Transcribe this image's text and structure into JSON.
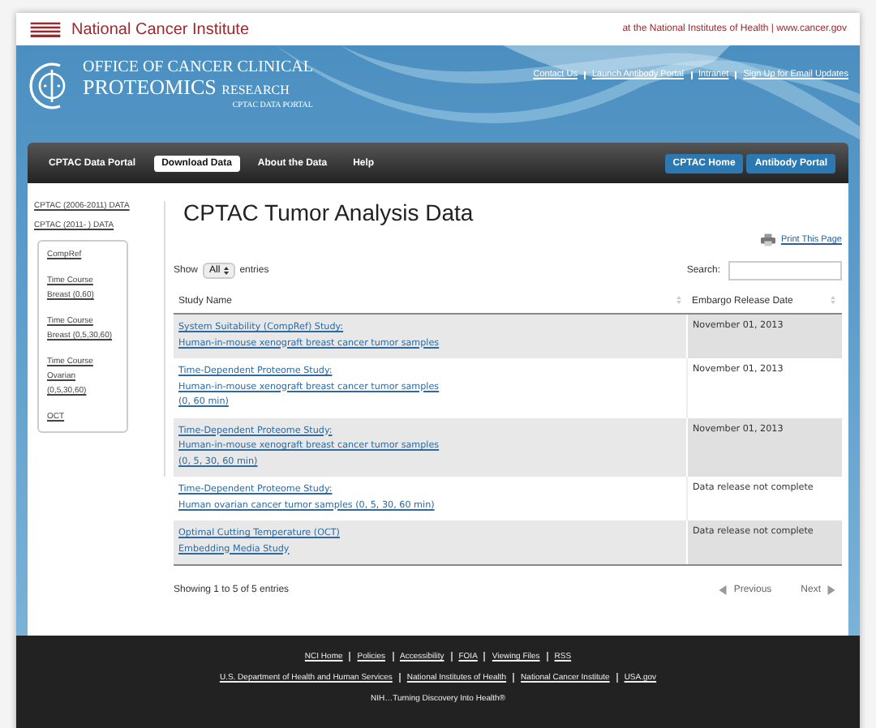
{
  "nci_bar": {
    "title": "National Cancer Institute",
    "tagline": "at the National Institutes of Health | www.cancer.gov"
  },
  "header": {
    "title_line1": "OFFICE OF CANCER CLINICAL",
    "title_line2": "PROTEOMICS",
    "title_line2_small": "RESEARCH",
    "subtitle": "CPTAC DATA PORTAL",
    "links": [
      "Contact Us",
      "Launch Antibody Portal",
      "Intranet",
      "Sign Up for Email Updates"
    ]
  },
  "nav": {
    "items": [
      {
        "label": "CPTAC Data Portal",
        "selected": false
      },
      {
        "label": "Download Data",
        "selected": true
      },
      {
        "label": "About the Data",
        "selected": false
      },
      {
        "label": "Help",
        "selected": false
      }
    ],
    "right_buttons": [
      "CPTAC Home",
      "Antibody Portal"
    ]
  },
  "sidebar": {
    "links": [
      "CPTAC (2006-2011) DATA",
      "CPTAC (2011- ) DATA"
    ],
    "box_items": [
      {
        "lines": [
          "CompRef"
        ]
      },
      {
        "lines": [
          "Time Course",
          "Breast (0,60)"
        ]
      },
      {
        "lines": [
          "Time Course",
          "Breast (0,5,30,60)"
        ]
      },
      {
        "lines": [
          "Time Course",
          "Ovarian",
          "(0,5,30,60)"
        ]
      },
      {
        "lines": [
          "OCT"
        ]
      }
    ]
  },
  "main": {
    "title": "CPTAC Tumor Analysis Data",
    "print_link": "Print This Page",
    "show_label": "Show",
    "show_value": "All",
    "entries_label": "entries",
    "search_label": "Search:",
    "table": {
      "columns": [
        "Study Name",
        "Embargo Release Date"
      ],
      "rows": [
        {
          "name_lines": [
            "System Suitability (CompRef) Study:",
            "Human-in-mouse xenograft breast cancer tumor samples"
          ],
          "date": "November 01, 2013"
        },
        {
          "name_lines": [
            "Time-Dependent Proteome Study:",
            "Human-in-mouse xenograft breast cancer tumor samples",
            "(0, 60 min)"
          ],
          "date": "November 01, 2013"
        },
        {
          "name_lines": [
            "Time-Dependent Proteome Study:",
            "Human-in-mouse xenograft breast cancer tumor samples",
            "(0, 5, 30, 60 min)"
          ],
          "date": "November 01, 2013"
        },
        {
          "name_lines": [
            "Time-Dependent Proteome Study:",
            "Human ovarian cancer tumor samples (0, 5, 30, 60 min)"
          ],
          "date": "Data release not complete"
        },
        {
          "name_lines": [
            "Optimal Cutting Temperature (OCT)",
            "Embedding Media Study"
          ],
          "date": "Data release not complete"
        }
      ]
    },
    "showing": "Showing 1 to 5 of 5 entries",
    "previous": "Previous",
    "next": "Next"
  },
  "footer": {
    "row1": [
      "NCI Home",
      "Policies",
      "Accessibility",
      "FOIA",
      "Viewing Files",
      "RSS"
    ],
    "row2": [
      "U.S. Department of Health and Human Services",
      "National Institutes of Health",
      "National Cancer Institute",
      "USA.gov"
    ],
    "tagline": "NIH…Turning Discovery Into Health®"
  }
}
